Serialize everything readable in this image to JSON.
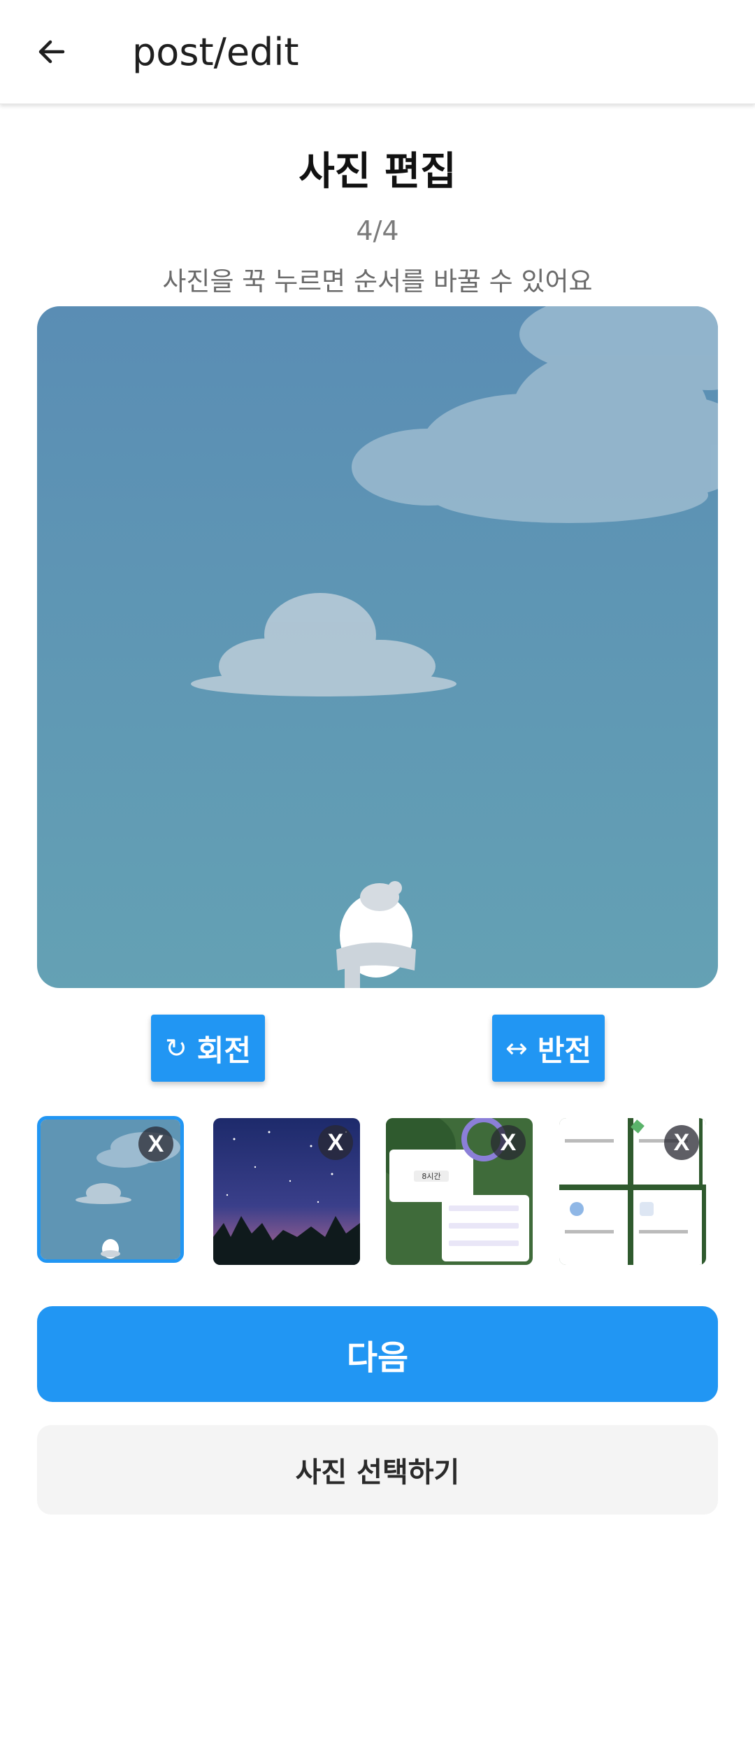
{
  "appbar": {
    "title": "post/edit",
    "back_icon": "arrow-left-icon"
  },
  "page": {
    "title": "사진 편집",
    "counter": "4/4",
    "hint": "사진을 꾹 누르면 순서를 바꿀 수 있어요"
  },
  "tools": {
    "rotate": {
      "icon": "rotate-icon",
      "glyph": "↻",
      "label": "회전"
    },
    "flip": {
      "icon": "flip-horizontal-icon",
      "glyph": "↔",
      "label": "반전"
    }
  },
  "thumbnails": {
    "remove_label": "X",
    "items": [
      {
        "id": "sky-snowman",
        "selected": true
      },
      {
        "id": "night-sky",
        "selected": false
      },
      {
        "id": "app-screenshot",
        "selected": false,
        "texts": [
          "8시간"
        ]
      },
      {
        "id": "card-grid",
        "selected": false
      }
    ]
  },
  "actions": {
    "next_label": "다음",
    "select_label": "사진 선택하기"
  },
  "colors": {
    "accent": "#2196f3",
    "sky_top": "#5b8fb4",
    "sky_bottom": "#63a0b4"
  }
}
